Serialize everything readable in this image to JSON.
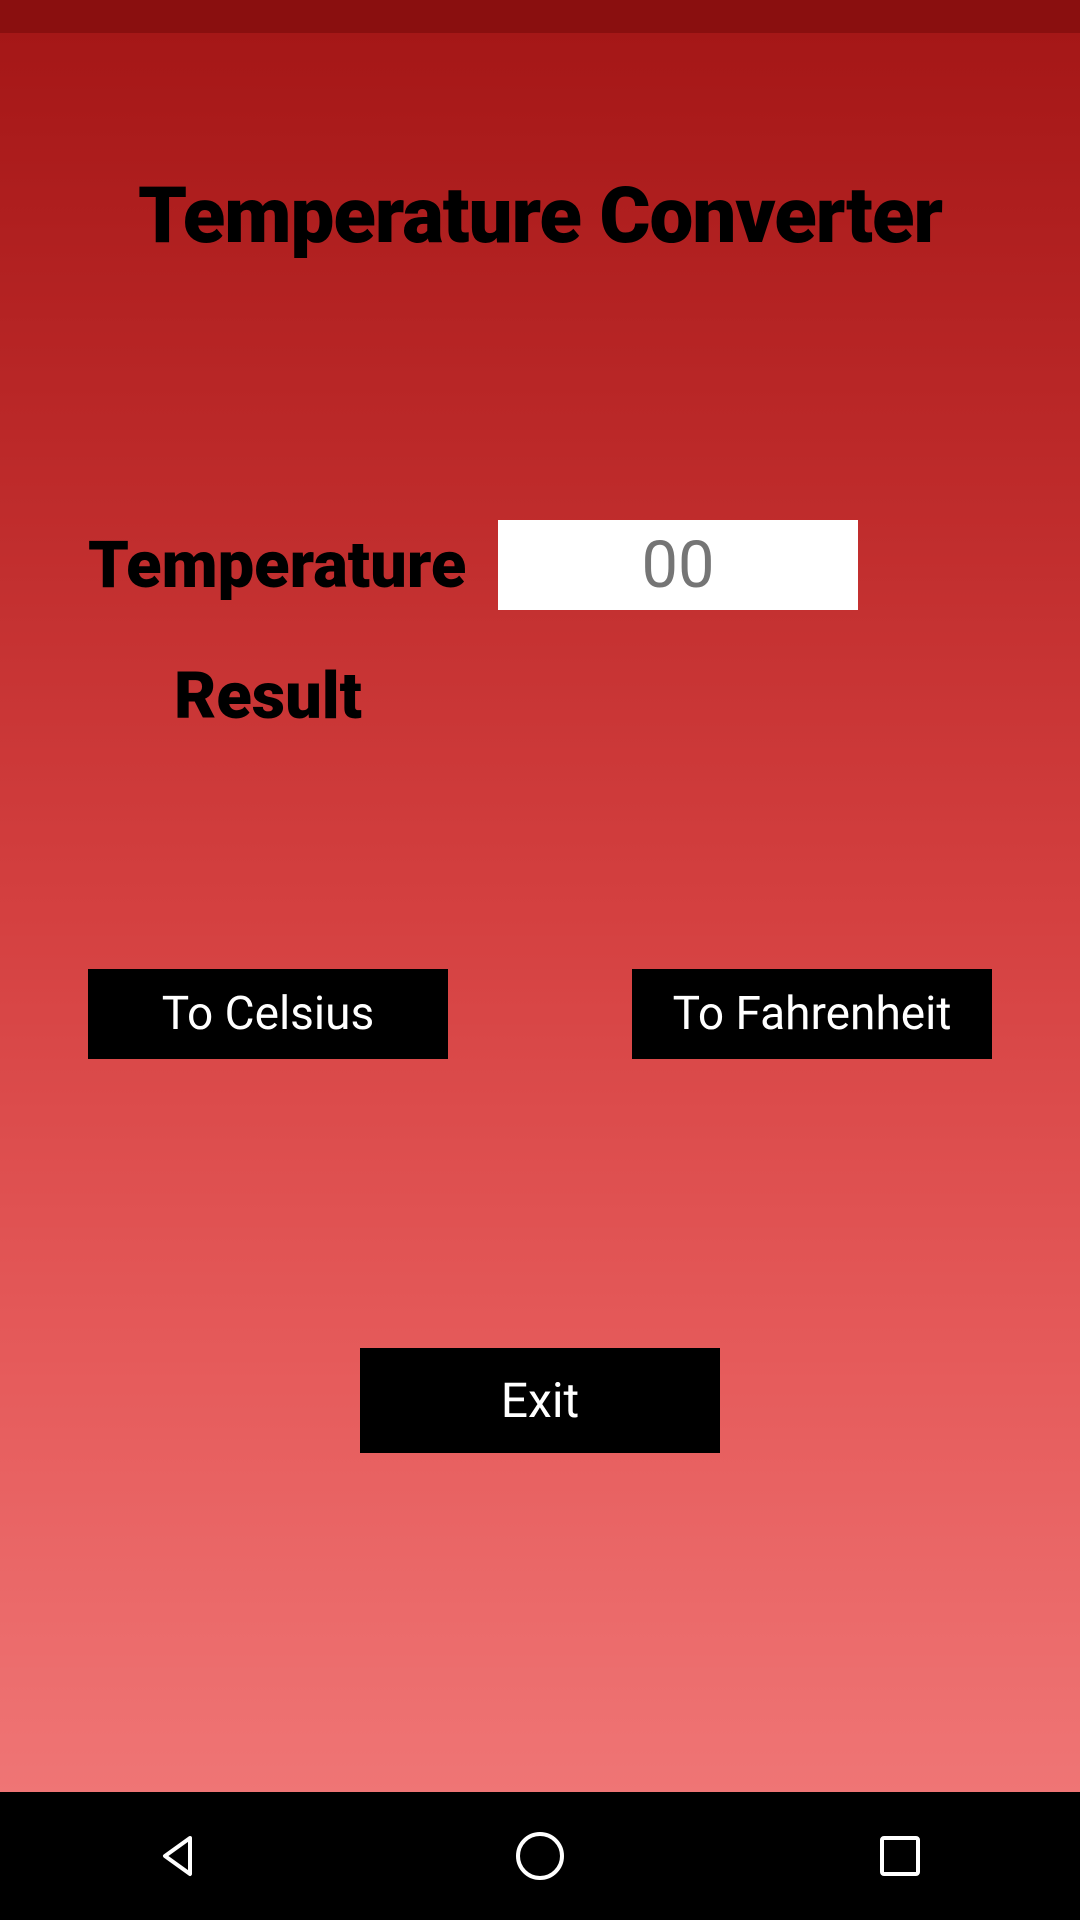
{
  "title": "Temperature Converter",
  "labels": {
    "temperature": "Temperature",
    "result": "Result"
  },
  "input": {
    "placeholder": "00"
  },
  "buttons": {
    "to_celsius": "To Celsius",
    "to_fahrenheit": "To Fahrenheit",
    "exit": "Exit"
  }
}
